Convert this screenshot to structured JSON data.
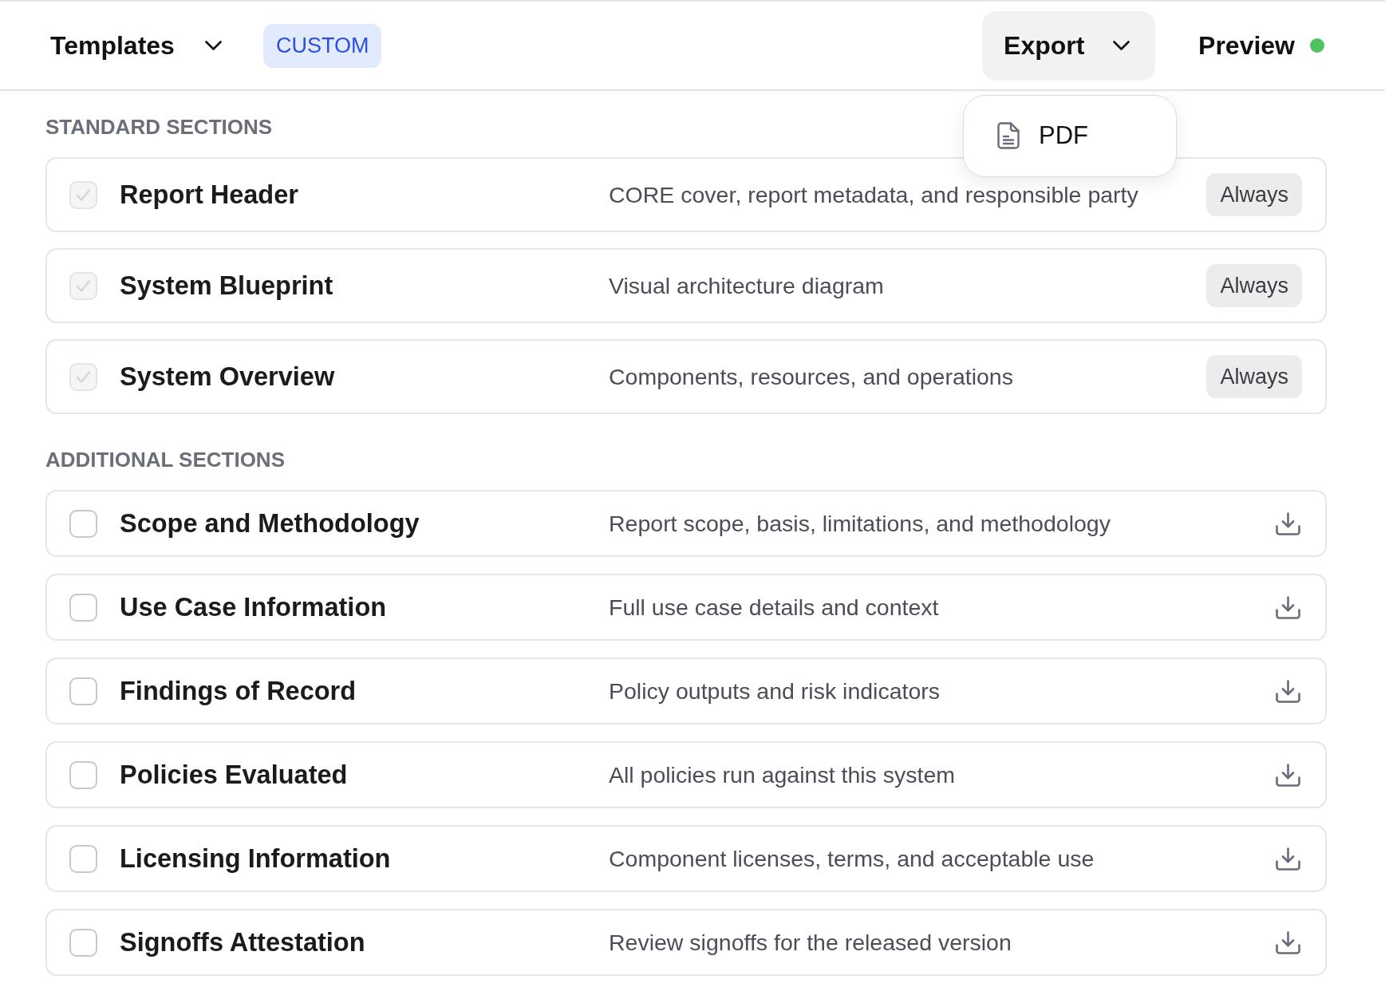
{
  "toolbar": {
    "templates": {
      "label": "Templates"
    },
    "mode_badge": "CUSTOM",
    "export": {
      "label": "Export",
      "expanded": true,
      "menu": [
        {
          "label": "PDF"
        }
      ]
    },
    "preview": {
      "label": "Preview",
      "on": true
    }
  },
  "section_groups": [
    {
      "title": "STANDARD SECTIONS",
      "sections": [
        {
          "kind": "always",
          "name": "Report Header",
          "description": "CORE cover, report metadata, and responsible party",
          "checked": true,
          "disabled": true,
          "badge": "Always"
        },
        {
          "kind": "always",
          "name": "System Blueprint",
          "description": "Visual architecture diagram",
          "checked": true,
          "disabled": true,
          "badge": "Always"
        },
        {
          "kind": "always",
          "name": "System Overview",
          "description": "Components, resources, and operations",
          "checked": true,
          "disabled": true,
          "badge": "Always"
        }
      ]
    },
    {
      "title": "ADDITIONAL SECTIONS",
      "sections": [
        {
          "kind": "optional",
          "name": "Scope and Methodology",
          "description": "Report scope, basis, limitations, and methodology",
          "checked": false,
          "disabled": false
        },
        {
          "kind": "optional",
          "name": "Use Case Information",
          "description": "Full use case details and context",
          "checked": false,
          "disabled": false
        },
        {
          "kind": "optional",
          "name": "Findings of Record",
          "description": "Policy outputs and risk indicators",
          "checked": false,
          "disabled": false
        },
        {
          "kind": "optional",
          "name": "Policies Evaluated",
          "description": "All policies run against this system",
          "checked": false,
          "disabled": false
        },
        {
          "kind": "optional",
          "name": "Licensing Information",
          "description": "Component licenses, terms, and acceptable use",
          "checked": false,
          "disabled": false
        },
        {
          "kind": "optional",
          "name": "Signoffs Attestation",
          "description": "Review signoffs for the released version",
          "checked": false,
          "disabled": false
        }
      ]
    }
  ]
}
